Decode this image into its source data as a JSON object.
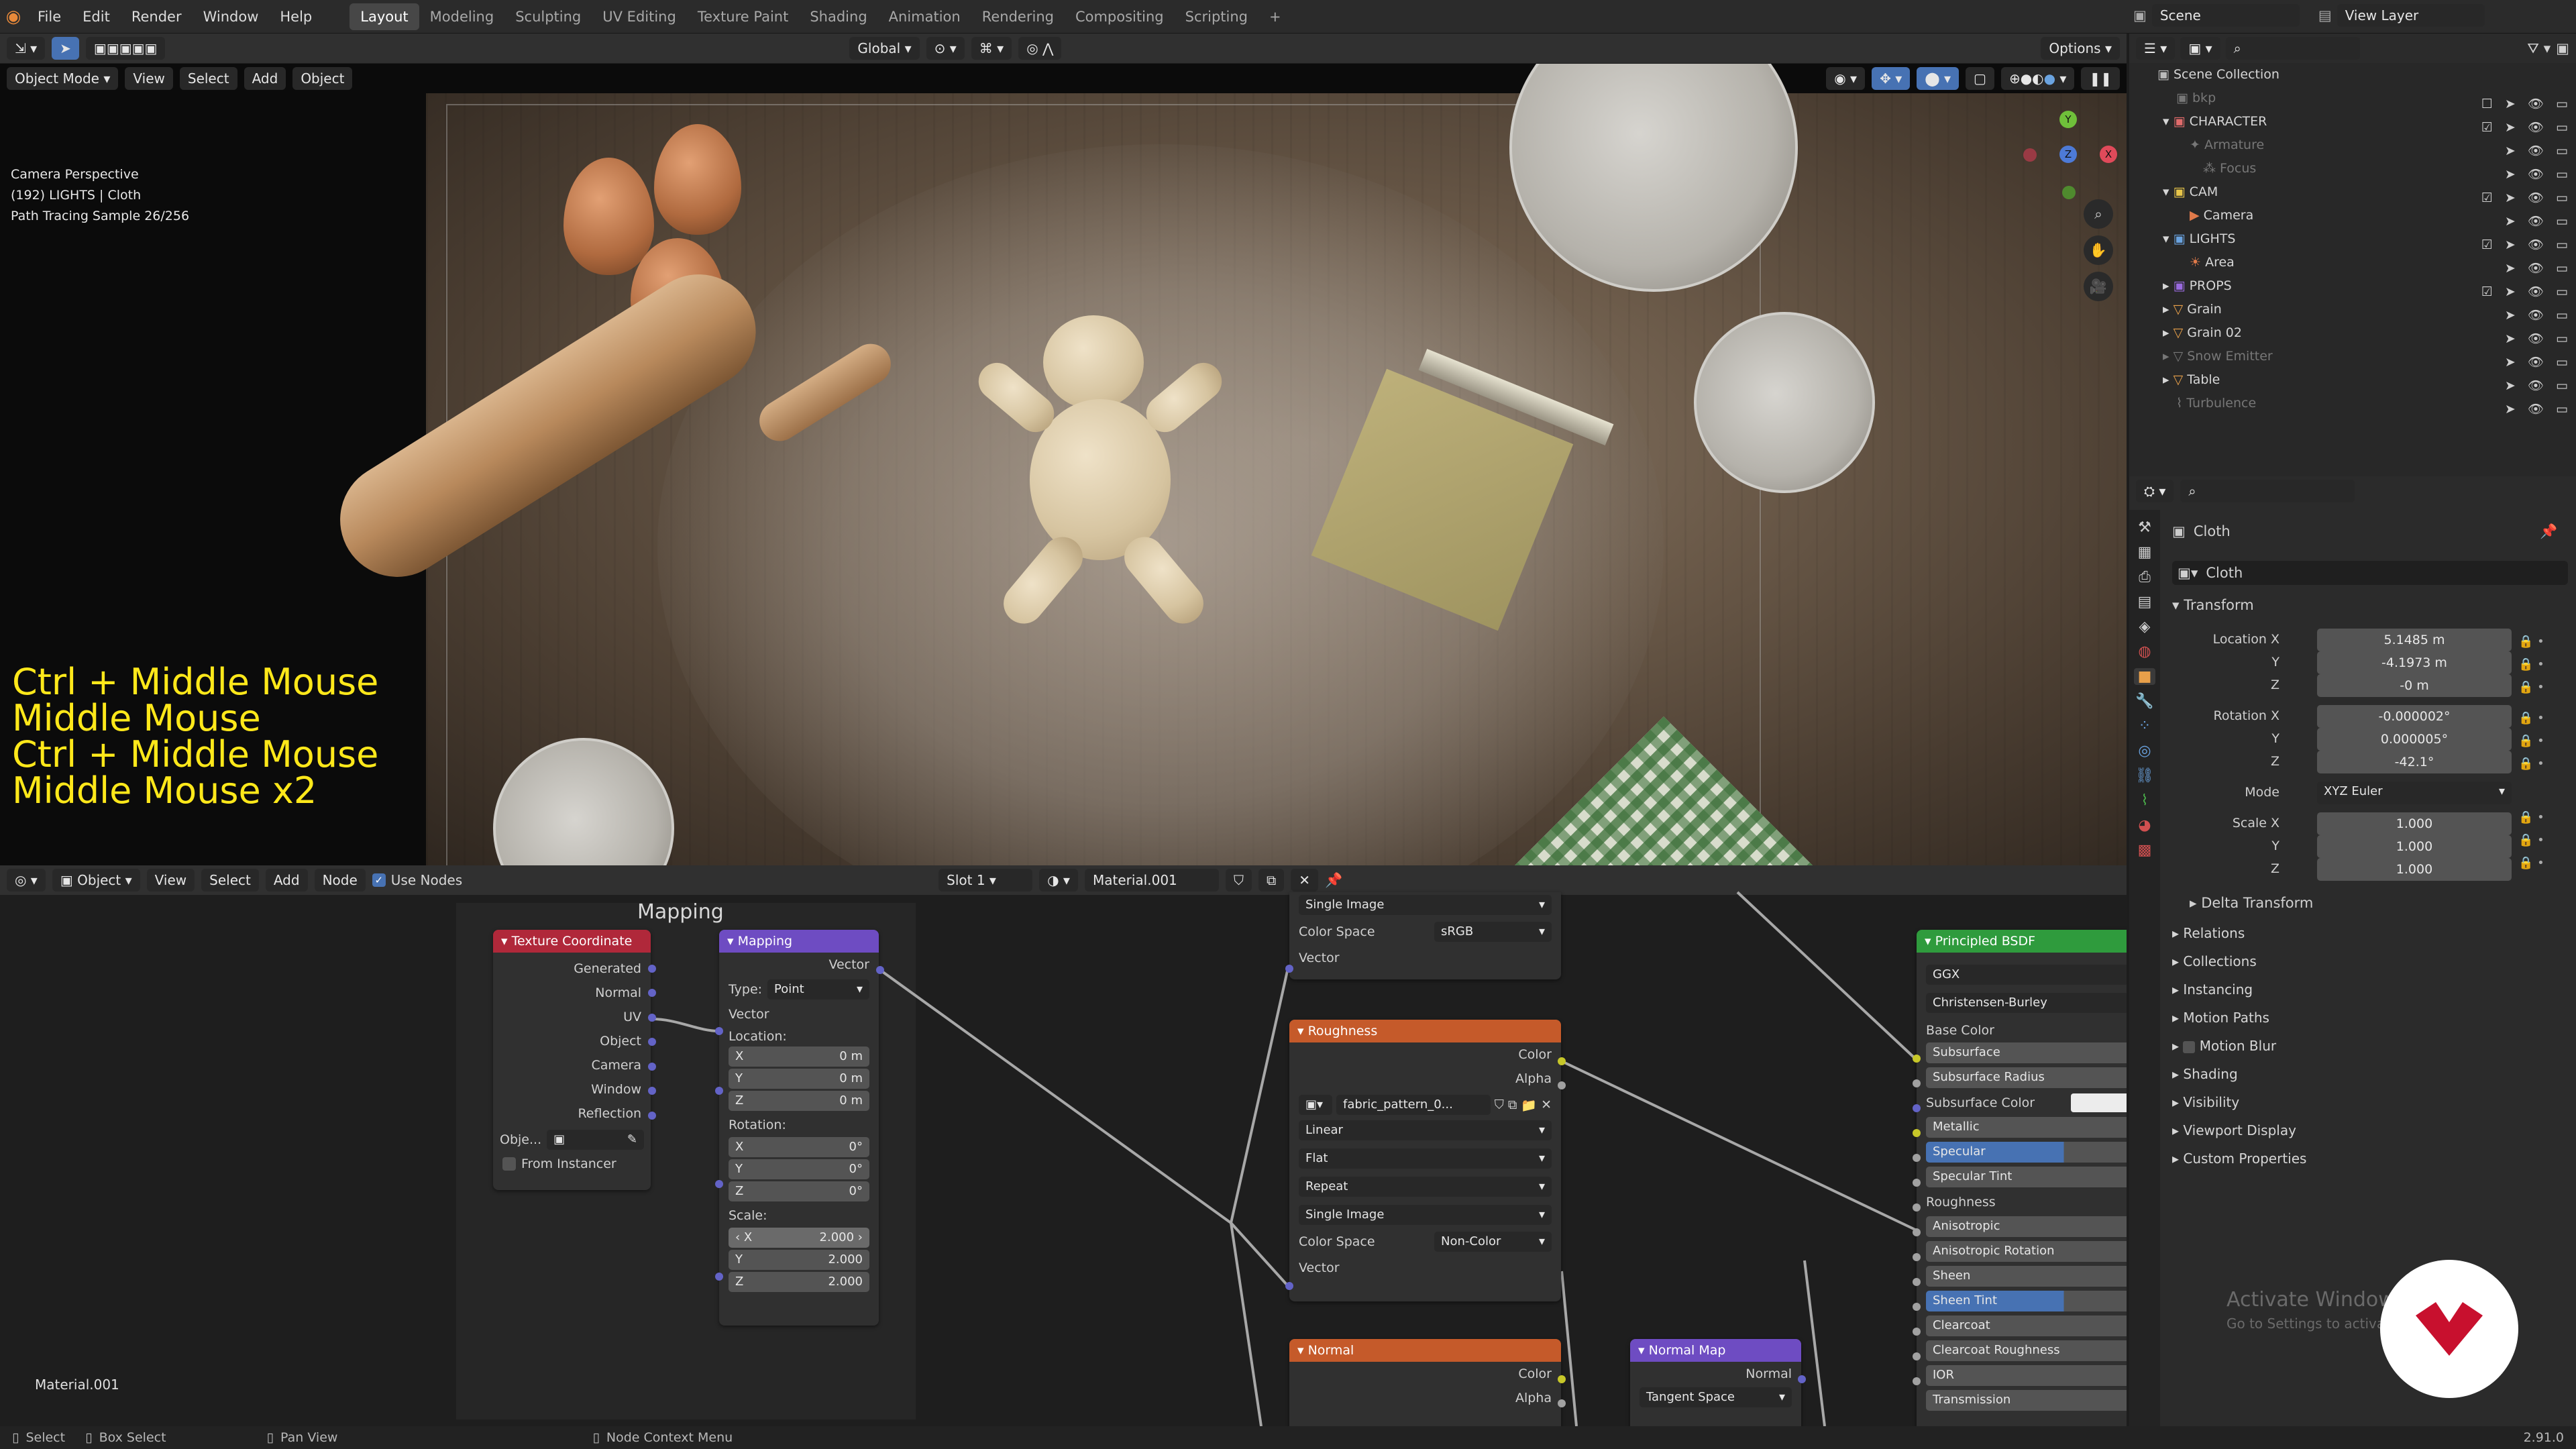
{
  "topbar": {
    "menus": [
      "File",
      "Edit",
      "Render",
      "Window",
      "Help"
    ],
    "workspaces": [
      "Layout",
      "Modeling",
      "Sculpting",
      "UV Editing",
      "Texture Paint",
      "Shading",
      "Animation",
      "Rendering",
      "Compositing",
      "Scripting"
    ],
    "active_workspace": "Layout",
    "scene": "Scene",
    "view_layer": "View Layer"
  },
  "viewport": {
    "mode": "Object Mode",
    "menus": [
      "View",
      "Select",
      "Add",
      "Object"
    ],
    "transform_orientation": "Global",
    "options": "Options",
    "info_lines": [
      "Camera Perspective",
      "(192) LIGHTS | Cloth",
      "Path Tracing Sample 26/256"
    ],
    "key_overlay": [
      "Ctrl + Middle Mouse",
      "Middle Mouse",
      "Ctrl + Middle Mouse",
      "Middle Mouse x2"
    ],
    "gizmo_axes": {
      "x": "X",
      "y": "Y",
      "z": "Z"
    }
  },
  "node_editor": {
    "type": "Object",
    "menus": [
      "View",
      "Select",
      "Add",
      "Node"
    ],
    "use_nodes": "Use Nodes",
    "slot": "Slot 1",
    "material": "Material.001",
    "frame_label": "Mapping",
    "bottom_material": "Material.001",
    "tex_coord": {
      "title": "Texture Coordinate",
      "outputs": [
        "Generated",
        "Normal",
        "UV",
        "Object",
        "Camera",
        "Window",
        "Reflection"
      ],
      "object_label": "Obje...",
      "from_instancer": "From Instancer"
    },
    "mapping": {
      "title": "Mapping",
      "output": "Vector",
      "type_label": "Type:",
      "type_value": "Point",
      "vector": "Vector",
      "location": "Location:",
      "loc": [
        {
          "a": "X",
          "v": "0 m"
        },
        {
          "a": "Y",
          "v": "0 m"
        },
        {
          "a": "Z",
          "v": "0 m"
        }
      ],
      "rotation": "Rotation:",
      "rot": [
        {
          "a": "X",
          "v": "0°"
        },
        {
          "a": "Y",
          "v": "0°"
        },
        {
          "a": "Z",
          "v": "0°"
        }
      ],
      "scale": "Scale:",
      "scl": [
        {
          "a": "X",
          "v": "2.000"
        },
        {
          "a": "Y",
          "v": "2.000"
        },
        {
          "a": "Z",
          "v": "2.000"
        }
      ]
    },
    "img_top": {
      "projection": "Single Image",
      "color_space_label": "Color Space",
      "color_space": "sRGB",
      "vector": "Vector"
    },
    "roughness": {
      "title": "Roughness",
      "outputs": [
        "Color",
        "Alpha"
      ],
      "image": "fabric_pattern_0...",
      "interpolation": "Linear",
      "projection": "Flat",
      "extension": "Repeat",
      "source": "Single Image",
      "color_space_label": "Color Space",
      "color_space": "Non-Color",
      "vector": "Vector"
    },
    "normal": {
      "title": "Normal",
      "outputs": [
        "Color",
        "Alpha"
      ]
    },
    "normal_map": {
      "title": "Normal Map",
      "output": "Normal",
      "space": "Tangent Space"
    },
    "bsdf": {
      "title": "Principled BSDF",
      "distribution": "GGX",
      "sss_method": "Christensen-Burley",
      "inputs": [
        "Base Color",
        "Subsurface",
        "Subsurface Radius",
        "Subsurface Color",
        "Metallic",
        "Specular",
        "Specular Tint",
        "Roughness",
        "Anisotropic",
        "Anisotropic Rotation",
        "Sheen",
        "Sheen Tint",
        "Clearcoat",
        "Clearcoat Roughness",
        "IOR",
        "Transmission"
      ]
    }
  },
  "outliner": {
    "title": "Scene Collection",
    "items": [
      {
        "name": "bkp",
        "level": 1,
        "dim": true
      },
      {
        "name": "CHARACTER",
        "level": 1,
        "color": "#e06b6b"
      },
      {
        "name": "Armature",
        "level": 2,
        "dim": true
      },
      {
        "name": "Focus",
        "level": 2,
        "dim": true
      },
      {
        "name": "CAM",
        "level": 1,
        "color": "#e8c64a"
      },
      {
        "name": "Camera",
        "level": 2
      },
      {
        "name": "LIGHTS",
        "level": 1,
        "color": "#6aa3e0"
      },
      {
        "name": "Area",
        "level": 2
      },
      {
        "name": "PROPS",
        "level": 1,
        "color": "#9a6ae0"
      },
      {
        "name": "Grain",
        "level": 1
      },
      {
        "name": "Grain 02",
        "level": 1
      },
      {
        "name": "Snow Emitter",
        "level": 1,
        "dim": true
      },
      {
        "name": "Table",
        "level": 1
      },
      {
        "name": "Turbulence",
        "level": 1,
        "dim": true
      }
    ]
  },
  "properties": {
    "object_name": "Cloth",
    "data_name": "Cloth",
    "transform": "Transform",
    "location_label": "Location X",
    "location": [
      "5.1485 m",
      "-4.1973 m",
      "-0 m"
    ],
    "rotation_label": "Rotation X",
    "rotation": [
      "-0.000002°",
      "0.000005°",
      "-42.1°"
    ],
    "mode_label": "Mode",
    "mode": "XYZ Euler",
    "scale_label": "Scale X",
    "scale": [
      "1.000",
      "1.000",
      "1.000"
    ],
    "y": "Y",
    "z": "Z",
    "delta": "Delta Transform",
    "panels": [
      "Relations",
      "Collections",
      "Instancing",
      "Motion Paths",
      "Motion Blur",
      "Shading",
      "Visibility",
      "Viewport Display",
      "Custom Properties"
    ],
    "watermark_title": "Activate Windows",
    "watermark_sub": "Go to Settings to activa..."
  },
  "statusbar": {
    "select": "Select",
    "box_select": "Box Select",
    "pan_view": "Pan View",
    "node_context": "Node Context Menu",
    "version": "2.91.0"
  },
  "colors": {
    "accent": "#4772b3",
    "tex_coord_header": "#b0283a",
    "mapping_header": "#6e4cc2",
    "image_header": "#c55a2a",
    "bsdf_header": "#2f9b3d",
    "key_overlay": "#ffe81a"
  }
}
